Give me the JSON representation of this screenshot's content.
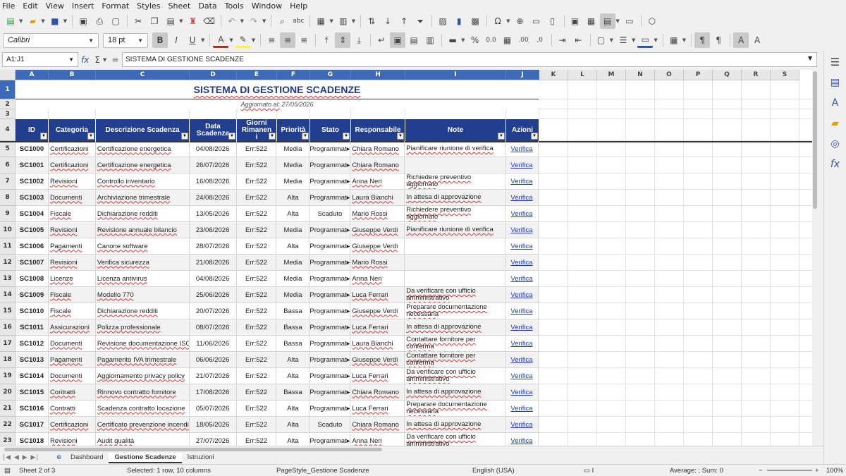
{
  "menu": [
    "File",
    "Edit",
    "View",
    "Insert",
    "Format",
    "Styles",
    "Sheet",
    "Data",
    "Tools",
    "Window",
    "Help"
  ],
  "toolbar": {
    "font_name": "Calibri",
    "font_size": "18 pt"
  },
  "formula_bar": {
    "cell_ref": "A1:J1",
    "content": "SISTEMA DI GESTIONE SCADENZE"
  },
  "columns": [
    "A",
    "B",
    "C",
    "D",
    "E",
    "F",
    "G",
    "H",
    "I",
    "J",
    "K",
    "L",
    "M",
    "N",
    "O",
    "P",
    "Q",
    "R",
    "S"
  ],
  "rows": [
    "1",
    "2",
    "3",
    "4",
    "5",
    "6",
    "7",
    "8",
    "9",
    "10",
    "11",
    "12",
    "13",
    "14",
    "15",
    "16",
    "17",
    "18",
    "19",
    "20",
    "21",
    "22",
    "23"
  ],
  "sheet": {
    "title": "SISTEMA DI GESTIONE SCADENZE",
    "update_label": "Aggiornato al:",
    "update_date": "27/05/2026",
    "headers": [
      {
        "label": "ID"
      },
      {
        "label": "Categoria"
      },
      {
        "label": "Descrizione Scadenza"
      },
      {
        "label": "Data\nScadenza"
      },
      {
        "label": "Giorni\nRimanen\ni"
      },
      {
        "label": "Priorità"
      },
      {
        "label": "Stato"
      },
      {
        "label": "Responsabile"
      },
      {
        "label": "Note"
      },
      {
        "label": "Azioni"
      }
    ],
    "rows": [
      {
        "id": "SC1000",
        "cat": "Certificazioni",
        "desc": "Certificazione energetica",
        "date": "04/08/2026",
        "days": "Err:522",
        "prio": "Media",
        "stato": "Programmat▸",
        "resp": "Chiara Romano",
        "note": "Pianificare riunione di verifica",
        "azione": "Verifica"
      },
      {
        "id": "SC1001",
        "cat": "Certificazioni",
        "desc": "Certificazione energetica",
        "date": "26/07/2026",
        "days": "Err:522",
        "prio": "Media",
        "stato": "Programmat▸",
        "resp": "Chiara Romano",
        "note": "",
        "azione": "Verifica"
      },
      {
        "id": "SC1002",
        "cat": "Revisioni",
        "desc": "Controllo inventario",
        "date": "16/08/2026",
        "days": "Err:522",
        "prio": "Media",
        "stato": "Programmat▸",
        "resp": "Anna Neri",
        "note": "Richiedere preventivo aggiornato",
        "azione": "Verifica"
      },
      {
        "id": "SC1003",
        "cat": "Documenti",
        "desc": "Archiviazione trimestrale",
        "date": "24/08/2026",
        "days": "Err:522",
        "prio": "Alta",
        "stato": "Programmat▸",
        "resp": "Laura Bianchi",
        "note": "In attesa di approvazione",
        "azione": "Verifica"
      },
      {
        "id": "SC1004",
        "cat": "Fiscale",
        "desc": "Dichiarazione redditi",
        "date": "13/05/2026",
        "days": "Err:522",
        "prio": "Alta",
        "stato": "Scaduto",
        "resp": "Mario Rossi",
        "note": "Richiedere preventivo aggiornato",
        "azione": "Verifica"
      },
      {
        "id": "SC1005",
        "cat": "Revisioni",
        "desc": "Revisione annuale bilancio",
        "date": "23/06/2026",
        "days": "Err:522",
        "prio": "Media",
        "stato": "Programmat▸",
        "resp": "Giuseppe Verdi",
        "note": "Pianificare riunione di verifica",
        "azione": "Verifica"
      },
      {
        "id": "SC1006",
        "cat": "Pagamenti",
        "desc": "Canone software",
        "date": "28/07/2026",
        "days": "Err:522",
        "prio": "Alta",
        "stato": "Programmat▸",
        "resp": "Giuseppe Verdi",
        "note": "",
        "azione": "Verifica"
      },
      {
        "id": "SC1007",
        "cat": "Revisioni",
        "desc": "Verifica sicurezza",
        "date": "21/08/2026",
        "days": "Err:522",
        "prio": "Media",
        "stato": "Programmat▸",
        "resp": "Mario Rossi",
        "note": "",
        "azione": "Verifica"
      },
      {
        "id": "SC1008",
        "cat": "Licenze",
        "desc": "Licenza antivirus",
        "date": "04/08/2026",
        "days": "Err:522",
        "prio": "Media",
        "stato": "Programmat▸",
        "resp": "Anna Neri",
        "note": "",
        "azione": "Verifica"
      },
      {
        "id": "SC1009",
        "cat": "Fiscale",
        "desc": "Modello 770",
        "date": "25/06/2026",
        "days": "Err:522",
        "prio": "Media",
        "stato": "Programmat▸",
        "resp": "Luca Ferrari",
        "note": "Da verificare con ufficio amministrativo",
        "azione": "Verifica"
      },
      {
        "id": "SC1010",
        "cat": "Fiscale",
        "desc": "Dichiarazione redditi",
        "date": "20/07/2026",
        "days": "Err:522",
        "prio": "Bassa",
        "stato": "Programmat▸",
        "resp": "Giuseppe Verdi",
        "note": "Preparare documentazione necessaria",
        "azione": "Verifica"
      },
      {
        "id": "SC1011",
        "cat": "Assicurazioni",
        "desc": "Polizza professionale",
        "date": "08/07/2026",
        "days": "Err:522",
        "prio": "Bassa",
        "stato": "Programmat▸",
        "resp": "Luca Ferrari",
        "note": "In attesa di approvazione",
        "azione": "Verifica"
      },
      {
        "id": "SC1012",
        "cat": "Documenti",
        "desc": "Revisione documentazione ISO",
        "date": "11/06/2026",
        "days": "Err:522",
        "prio": "Bassa",
        "stato": "Programmat▸",
        "resp": "Laura Bianchi",
        "note": "Contattare fornitore per conferma",
        "azione": "Verifica"
      },
      {
        "id": "SC1013",
        "cat": "Pagamenti",
        "desc": "Pagamento IVA trimestrale",
        "date": "06/06/2026",
        "days": "Err:522",
        "prio": "Alta",
        "stato": "Programmat▸",
        "resp": "Giuseppe Verdi",
        "note": "Contattare fornitore per conferma",
        "azione": "Verifica"
      },
      {
        "id": "SC1014",
        "cat": "Documenti",
        "desc": "Aggiornamento privacy policy",
        "date": "21/07/2026",
        "days": "Err:522",
        "prio": "Alta",
        "stato": "Programmat▸",
        "resp": "Luca Ferrari",
        "note": "Da verificare con ufficio amministrativo",
        "azione": "Verifica"
      },
      {
        "id": "SC1015",
        "cat": "Contratti",
        "desc": "Rinnovo contratto fornitore",
        "date": "17/08/2026",
        "days": "Err:522",
        "prio": "Bassa",
        "stato": "Programmat▸",
        "resp": "Chiara Romano",
        "note": "In attesa di approvazione",
        "azione": "Verifica"
      },
      {
        "id": "SC1016",
        "cat": "Contratti",
        "desc": "Scadenza contratto locazione",
        "date": "05/07/2026",
        "days": "Err:522",
        "prio": "Alta",
        "stato": "Programmat▸",
        "resp": "Luca Ferrari",
        "note": "Preparare documentazione necessaria",
        "azione": "Verifica"
      },
      {
        "id": "SC1017",
        "cat": "Certificazioni",
        "desc": "Certificato prevenzione incendi",
        "date": "18/05/2026",
        "days": "Err:522",
        "prio": "Alta",
        "stato": "Scaduto",
        "resp": "Chiara Romano",
        "note": "In attesa di approvazione",
        "azione": "Verifica"
      },
      {
        "id": "SC1018",
        "cat": "Revisioni",
        "desc": "Audit qualità",
        "date": "27/07/2026",
        "days": "Err:522",
        "prio": "Alta",
        "stato": "Programmat▸",
        "resp": "Anna Neri",
        "note": "Da verificare con ufficio amministrativo",
        "azione": "Verifica"
      }
    ]
  },
  "tabs": [
    "Dashboard",
    "Gestione Scadenze",
    "Istruzioni"
  ],
  "active_tab": "Gestione Scadenze",
  "status": {
    "sheet": "Sheet 2 of 3",
    "selection": "Selected: 1 row, 10 columns",
    "page_style": "PageStyle_Gestione Scadenze",
    "language": "English (USA)",
    "sum": "Average: ; Sum: 0",
    "zoom": "100%"
  },
  "colors": {
    "header_bg": "#223f8f",
    "title_color": "#1f3a8a",
    "selection": "#3c6ab8"
  }
}
